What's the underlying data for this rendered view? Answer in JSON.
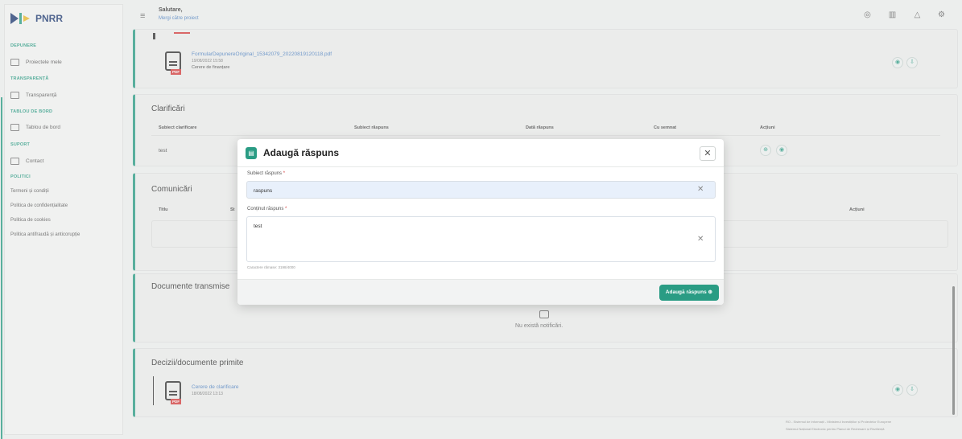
{
  "app": {
    "brand": "PNRR"
  },
  "sidebar": {
    "sections": [
      "DEPUNERE",
      "TRANSPARENȚĂ",
      "TABLOU DE BORD",
      "SUPORT",
      "POLITICI"
    ],
    "items": [
      {
        "label": "Proiectele mele",
        "icon": "folder-icon"
      },
      {
        "label": "Transparență",
        "icon": "table-icon"
      },
      {
        "label": "Tablou de bord",
        "icon": "dashboard-icon"
      },
      {
        "label": "Contact",
        "icon": "mail-icon"
      }
    ],
    "links": [
      "Termeni și condiții",
      "Politica de confidențialitate",
      "Politica de cookies",
      "Politica antifraudă și anticorupție"
    ]
  },
  "topbar": {
    "greeting": "Salutare,",
    "subtitle": "Mergi către proiect"
  },
  "file_card": {
    "file_name": "FormularDepunereOriginal_15342079_20220819120118.pdf",
    "file_date": "19/08/2022 15:58",
    "file_type": "Cerere de finanțare"
  },
  "clarificari": {
    "title": "Clarificări",
    "headers": [
      "Subiect clarificare",
      "Subiect răspuns",
      "Dată răspuns",
      "Cu semnat",
      "Acțiuni"
    ],
    "row": [
      "test"
    ]
  },
  "comunicari": {
    "title": "Comunicări",
    "headers": [
      "Titlu",
      "St",
      "Acțiuni"
    ]
  },
  "documente_transmise": {
    "title": "Documente transmise",
    "empty": "Nu există notificări."
  },
  "decizii": {
    "title": "Decizii/documente primite",
    "file_name": "Cerere de clarificare",
    "file_date": "18/08/2022 13:13"
  },
  "modal": {
    "title": "Adaugă răspuns",
    "subject_label": "Subiect răspuns",
    "subject_value": "raspuns",
    "content_label": "Conținut răspuns",
    "content_value": "test",
    "hint": "Caractere rămase: 3198/4000",
    "submit": "Adaugă răspuns"
  },
  "footer": {
    "line1": "RO - Sistemul de informații - Ministerul Investițiilor și Proiectelor Europene",
    "line2": "Sistemul Național Electronic pentru Planul de Redresare și Reziliență"
  },
  "colors": {
    "accent": "#2a9c84",
    "brand": "#1e3a72",
    "required": "#d43d3d"
  }
}
